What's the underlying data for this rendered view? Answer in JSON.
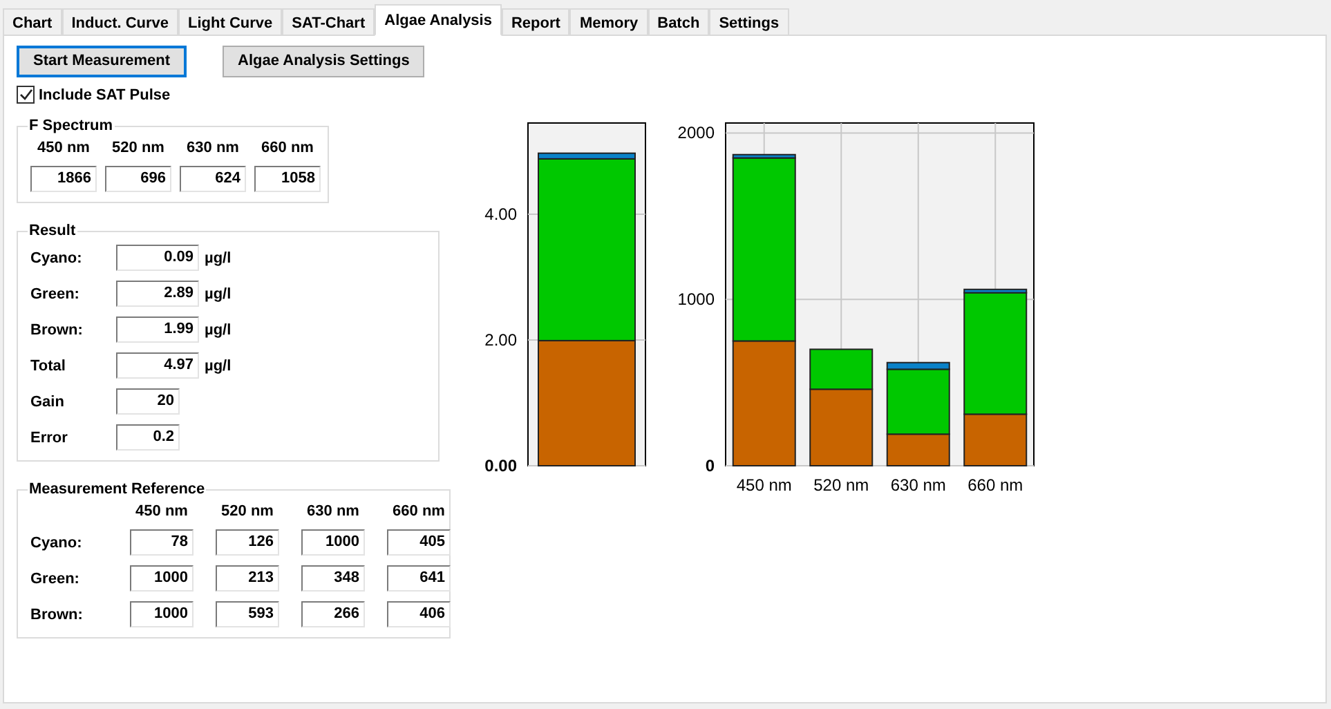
{
  "tabs": [
    {
      "label": "Chart",
      "selected": false
    },
    {
      "label": "Induct. Curve",
      "selected": false
    },
    {
      "label": "Light Curve",
      "selected": false
    },
    {
      "label": "SAT-Chart",
      "selected": false
    },
    {
      "label": "Algae Analysis",
      "selected": true
    },
    {
      "label": "Report",
      "selected": false
    },
    {
      "label": "Memory",
      "selected": false
    },
    {
      "label": "Batch",
      "selected": false
    },
    {
      "label": "Settings",
      "selected": false
    }
  ],
  "buttons": [
    {
      "label": "Start Measurement",
      "focused": true
    },
    {
      "label": "Algae Analysis Settings",
      "focused": false
    }
  ],
  "include_sat_pulse": {
    "label": "Include SAT Pulse",
    "checked": true
  },
  "f_spectrum": {
    "title": "F Spectrum",
    "columns": [
      "450 nm",
      "520 nm",
      "630 nm",
      "660 nm"
    ],
    "values": [
      "1866",
      "696",
      "624",
      "1058"
    ]
  },
  "result": {
    "title": "Result",
    "rows": [
      {
        "label": "Cyano:",
        "value": "0.09",
        "unit": "µg/l"
      },
      {
        "label": "Green:",
        "value": "2.89",
        "unit": "µg/l"
      },
      {
        "label": "Brown:",
        "value": "1.99",
        "unit": "µg/l"
      },
      {
        "label": "Total",
        "value": "4.97",
        "unit": "µg/l"
      },
      {
        "label": "Gain",
        "value": "20"
      },
      {
        "label": "Error",
        "value": "0.2"
      }
    ]
  },
  "measurement_reference": {
    "title": "Measurement Reference",
    "columns": [
      "450 nm",
      "520 nm",
      "630 nm",
      "660 nm"
    ],
    "rows": [
      {
        "label": "Cyano:",
        "values": [
          "78",
          "126",
          "1000",
          "405"
        ]
      },
      {
        "label": "Green:",
        "values": [
          "1000",
          "213",
          "348",
          "641"
        ]
      },
      {
        "label": "Brown:",
        "values": [
          "1000",
          "593",
          "266",
          "406"
        ]
      }
    ]
  },
  "total_chart": {
    "chart_data": {
      "type": "bar",
      "stacked": true,
      "grid": true,
      "ylim": [
        0,
        5.45
      ],
      "yticks": [
        {
          "value": 0,
          "label": "0.00"
        },
        {
          "value": 2,
          "label": "2.00"
        },
        {
          "value": 4,
          "label": "4.00"
        }
      ],
      "categories": [
        null
      ],
      "series": [
        {
          "color": "#c86400",
          "values": [
            1.99
          ]
        },
        {
          "color": "#00c800",
          "values": [
            2.89
          ]
        },
        {
          "color": "#0a82c8",
          "values": [
            0.09
          ]
        }
      ]
    }
  },
  "spectrum_chart": {
    "chart_data": {
      "type": "bar",
      "stacked": true,
      "grid": true,
      "ylim": [
        0,
        2060
      ],
      "yticks": [
        0,
        1000,
        2000
      ],
      "categories": [
        "450 nm",
        "520 nm",
        "630 nm",
        "660 nm"
      ],
      "series": [
        {
          "color": "#c86400",
          "values": [
            750,
            460,
            190,
            310
          ]
        },
        {
          "color": "#00c800",
          "values": [
            1100,
            240,
            390,
            730
          ]
        },
        {
          "color": "#0a82c8",
          "values": [
            20,
            0,
            40,
            20
          ]
        }
      ]
    }
  }
}
